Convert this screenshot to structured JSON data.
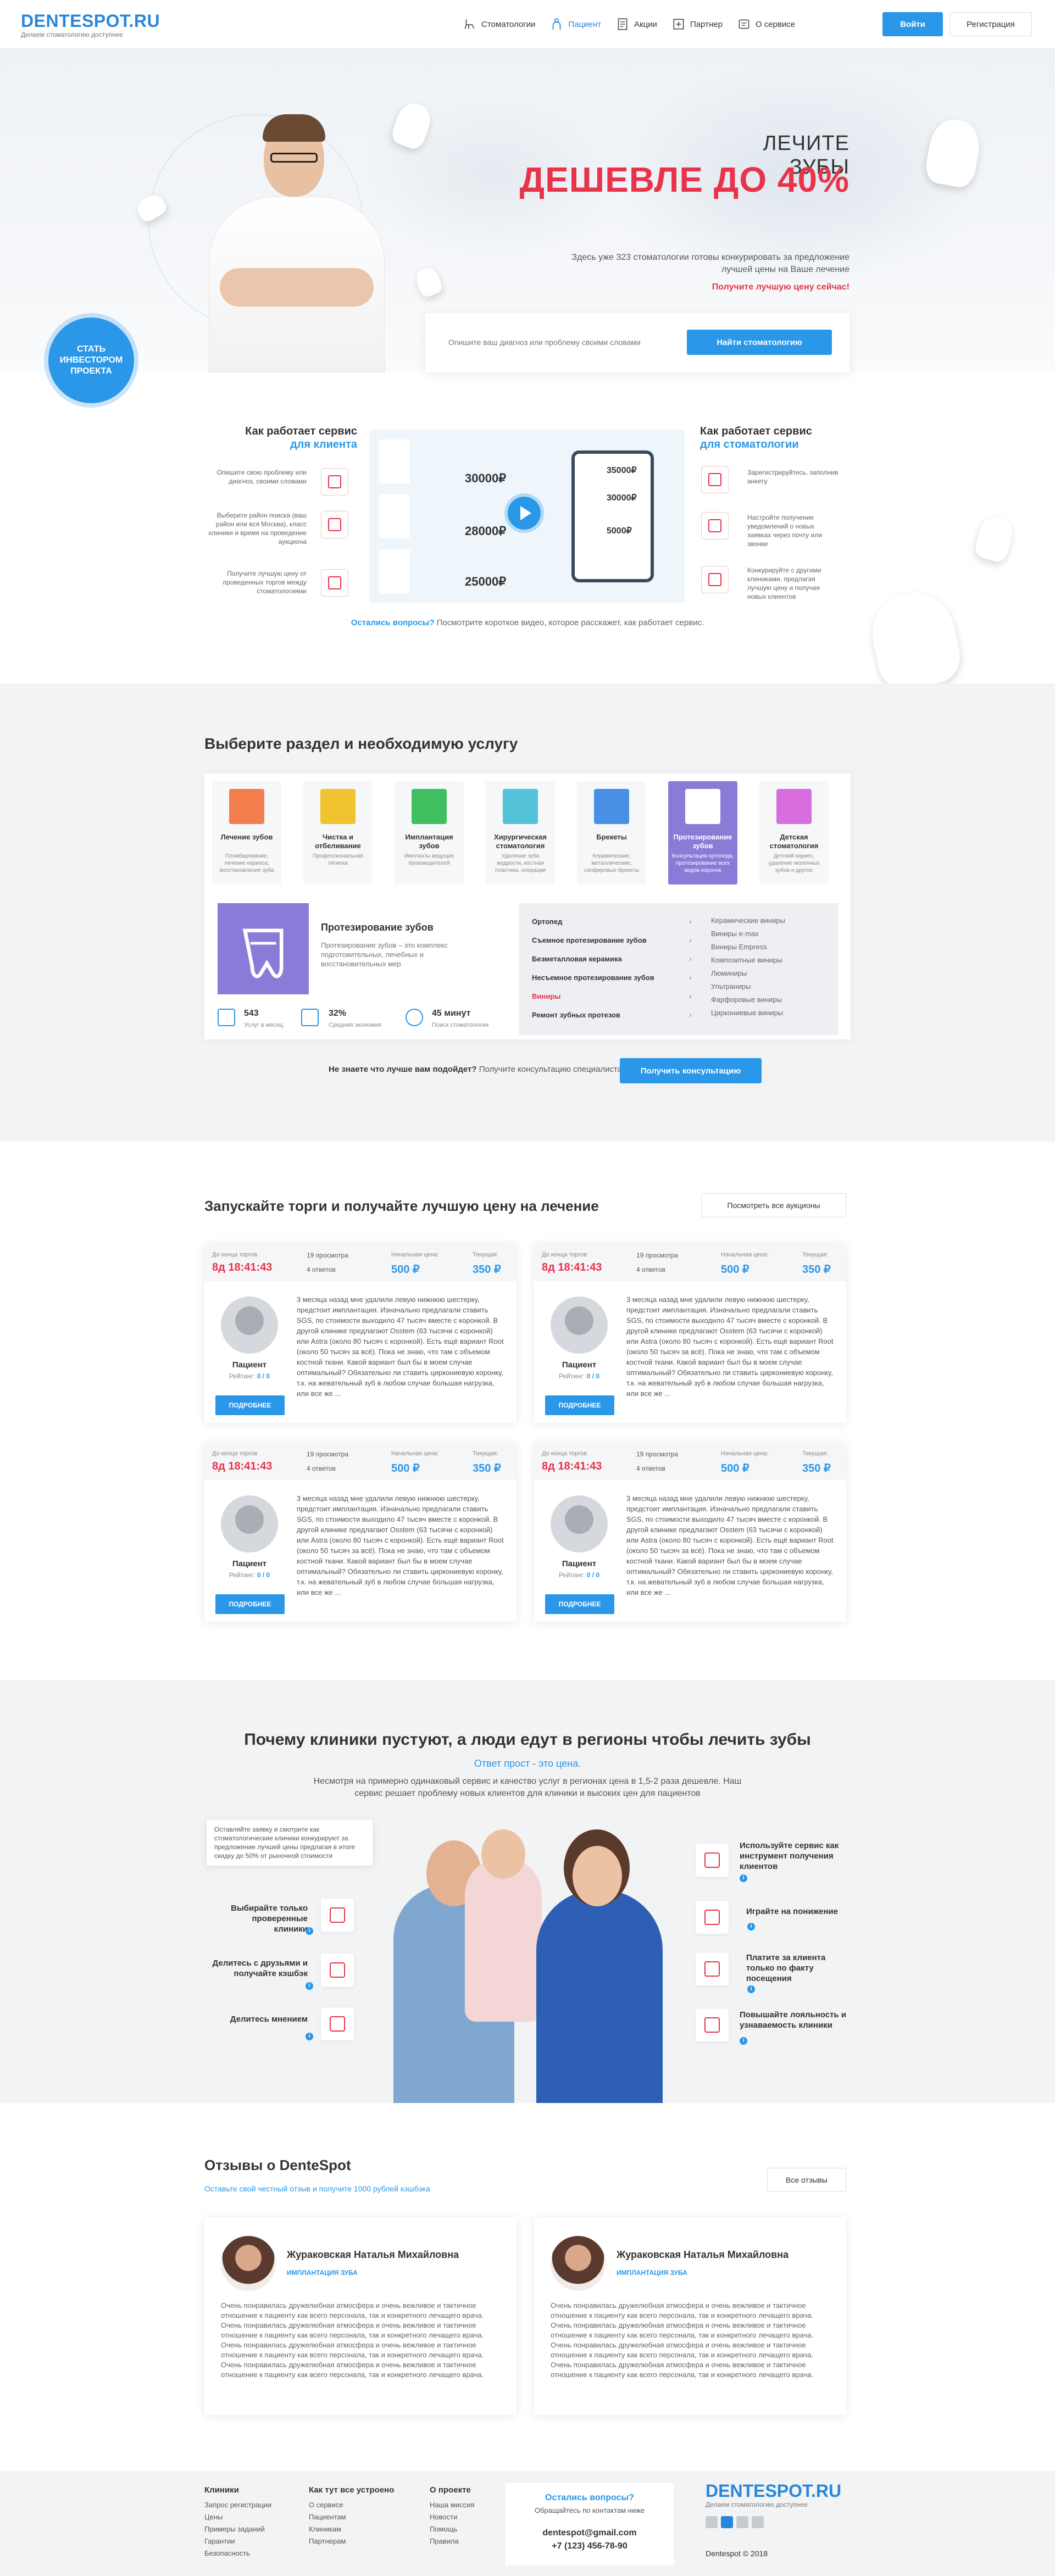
{
  "header": {
    "logo": "DENTESPOT.RU",
    "logo_sub": "Делаем стоматологию доступнее",
    "nav": [
      "Стоматологии",
      "Пациент",
      "Акции",
      "Партнер",
      "О сервисе"
    ],
    "login": "Войти",
    "register": "Регистрация"
  },
  "hero": {
    "line1": "ЛЕЧИТЕ ЗУБЫ",
    "line2": "ДЕШЕВЛЕ ДО 40%",
    "desc": "Здесь уже 323 стоматологии готовы конкурировать за предложение лучшей цены на Ваше лечение",
    "cta": "Получите лучшую цену сейчас!",
    "input_placeholder": "Опишите ваш диагноз или проблему своими словами",
    "search_button": "Найти стоматологию",
    "investor": "СТАТЬ ИНВЕСТОРОМ ПРОЕКТА"
  },
  "how": {
    "client_title": "Как работает сервис",
    "client_sub": "для клиента",
    "client_items": [
      "Опишите свою проблему или диагноз, своими словами",
      "Выберите район поиска (ваш район или вся Москва), класс клиники и время на проведение аукциона",
      "Получите лучшую цену от проведенных торгов между стоматологиями"
    ],
    "clinic_title": "Как работает сервис",
    "clinic_sub": "для стоматологии",
    "clinic_items": [
      "Зарегистрируйтесь, заполнив анкету",
      "Настройте получение уведомлений о новых заявках через почту или звонки",
      "Конкурируйте с другими клиниками, предлагая лучшую цену и получая новых клиентов"
    ],
    "video_prices": [
      "30000₽",
      "28000₽",
      "25000₽",
      "35000₽",
      "30000₽",
      "5000₽"
    ],
    "question": "Остались вопросы?",
    "question_rest": " Посмотрите короткое видео, которое расскажет, как работает сервис."
  },
  "services": {
    "title": "Выберите раздел и необходимую услугу",
    "cards": [
      {
        "name": "Лечение зубов",
        "desc": "Пломбирование, лечение кариеса, восстановление зуба",
        "color": "#f27d4d"
      },
      {
        "name": "Чистка и отбеливание",
        "desc": "Профессиональная гигиена",
        "color": "#f0c331"
      },
      {
        "name": "Имплантация зубов",
        "desc": "Импланты ведущих производителей",
        "color": "#3fbf5f"
      },
      {
        "name": "Хирургическая стоматология",
        "desc": "Удаление зуба мудрости, костная пластика, операции",
        "color": "#54c3d9"
      },
      {
        "name": "Брекеты",
        "desc": "Керамические, металлические, сапфировые брекеты",
        "color": "#4a8fe6"
      },
      {
        "name": "Протезирование зубов",
        "desc": "Консультация ортопеда, протезирование всех видов коронок",
        "color": "#8b7bd8"
      },
      {
        "name": "Детская стоматология",
        "desc": "Детский кариес, удаление молочных зубов и другое",
        "color": "#d86de0"
      }
    ],
    "detail_title": "Протезирование зубов",
    "detail_text": "Протезирование зубов – это комплекс подготовительных, лечебных и восстановительных мер",
    "stats": [
      {
        "value": "543",
        "label": "Услуг в месяц"
      },
      {
        "value": "32%",
        "label": "Средняя экономия"
      },
      {
        "value": "45 минут",
        "label": "Поиск стоматологии"
      }
    ],
    "menu_left": [
      "Ортопед",
      "Съемное протезирование зубов",
      "Безметалловая керамика",
      "Несъемное протезирование зубов",
      "Виниры",
      "Ремонт зубных протезов"
    ],
    "menu_right": [
      "Керамические виниры",
      "Виниры e-max",
      "Виниры Empress",
      "Композитные виниры",
      "Люминиры",
      "Ультраниры",
      "Фарфоровые виниры",
      "Циркониевые виниры"
    ],
    "consult_q": "Не знаете что лучше вам подойдет?",
    "consult_rest": " Получите консультацию специалиста",
    "consult_btn": "Получить консультацию"
  },
  "auctions": {
    "title": "Запускайте торги и получайте лучшую цену на лечение",
    "all_btn": "Посмотреть все аукционы",
    "label_end": "До конца торгов",
    "timer": "8д 18:41:43",
    "views": "19 просмотра",
    "offers": "4 ответов",
    "label_start": "Начальная цена:",
    "start_price": "500 ₽",
    "label_current": "Текущая:",
    "current_price": "350 ₽",
    "patient": "Пациент",
    "rating_label": "Рейтинг: ",
    "rating": "0 / 0",
    "more": "ПОДРОБНЕЕ",
    "text": "3 месяца назад мне удалили левую нижнюю шестерку, предстоит имплантация. Изначально предлагали ставить SGS, по стоимости выходило 47 тысяч вместе с коронкой. В другой клинике предлагают Osstem (63 тысячи с коронкой) или Astra (около 80 тысяч с коронкой). Есть ещё вариант Root (около 50 тысяч за всё). Пока не знаю, что там с объемом костной ткани. Какой вариант был бы в моем случае оптимальный? Обязательно ли ставить циркониевую коронку, т.к. на жевательный зуб в любом случае большая нагрузка, или все же ..."
  },
  "why": {
    "title": "Почему клиники пустуют, а люди едут в регионы чтобы лечить зубы",
    "sub": "Ответ прост - это цена.",
    "desc": "Несмотря на примерно одинаковый сервис и качество услуг в регионах цена в 1,5-2 раза дешевле. Наш сервис решает проблему новых клиентов для клиники и высоких цен для пациентов",
    "tooltip": "Оставляйте заявку и смотрите как стоматологические клиники конкурируют за предложение лучшей цены предлагая в итоге скидку до 50% от рыночной стоимости",
    "left": [
      "Выбирайте только проверенные клиники",
      "Делитесь с друзьями и получайте кэшбэк",
      "Делитесь мнением"
    ],
    "right": [
      "Используйте сервис как инструмент получения клиентов",
      "Играйте на понижение",
      "Платите за клиента только по факту посещения",
      "Повышайте лояльность и узнаваемость клиники"
    ]
  },
  "reviews": {
    "title": "Отзывы о DenteSpot",
    "sub": "Оставьте свой честный отзыв и получите 1000 рублей кэшбэка",
    "all_btn": "Все отзывы",
    "name": "Жураковская Наталья Михайловна",
    "tag": "ИМПЛАНТАЦИЯ ЗУБА",
    "text": "Очень понравилась дружелюбная атмосфера и очень вежливое и тактичное отношение к пациенту как всего персонала, так и конкретного лечащего врача. Очень понравилась дружелюбная атмосфера и очень вежливое и тактичное отношение к пациенту как всего персонала, так и конкретного лечащего врача. Очень понравилась дружелюбная атмосфера и очень вежливое и тактичное отношение к пациенту как всего персонала, так и конкретного лечащего врача. Очень понравилась дружелюбная атмосфера и очень вежливое и тактичное отношение к пациенту как всего персонала, так и конкретного лечащего врача."
  },
  "footer": {
    "col1_title": "Клиники",
    "col1": [
      "Запрос регистрации",
      "Цены",
      "Примеры заданий",
      "Гарантии",
      "Безопасность"
    ],
    "col2_title": "Как тут все устроено",
    "col2": [
      "О сервисе",
      "Пациентам",
      "Клиникам",
      "Партнерам"
    ],
    "col3_title": "О проекте",
    "col3": [
      "Наша миссия",
      "Новости",
      "Помощь",
      "Правила"
    ],
    "q": "Остались вопросы?",
    "q_sub": "Обращайтесь по контактам ниже",
    "email": "dentespot@gmail.com",
    "phone": "+7 (123) 456-78-90",
    "logo": "DENTESPOT.RU",
    "logo_sub": "Делаем стоматологию доступнее",
    "copy": "Dentespot © 2018"
  }
}
